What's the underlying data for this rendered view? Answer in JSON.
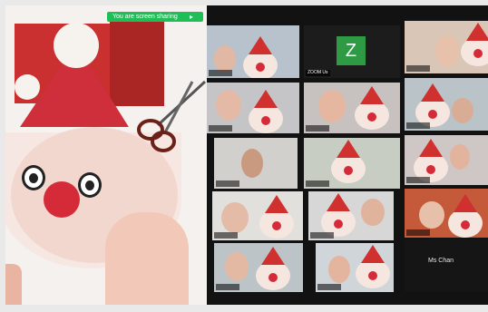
{
  "share": {
    "banner_text": "You are screen sharing",
    "banner_icon": "pin-icon"
  },
  "gallery": {
    "tiles": [
      {
        "id": "t1",
        "label": ""
      },
      {
        "id": "t2",
        "label": "ZOOM Us",
        "avatar_letter": "Z"
      },
      {
        "id": "t3",
        "label": ""
      },
      {
        "id": "t4",
        "label": ""
      },
      {
        "id": "t5",
        "label": ""
      },
      {
        "id": "t6",
        "label": ""
      },
      {
        "id": "t7",
        "label": ""
      },
      {
        "id": "t8",
        "label": ""
      },
      {
        "id": "t9",
        "label": ""
      },
      {
        "id": "t10",
        "label": ""
      },
      {
        "id": "t11",
        "label": ""
      },
      {
        "id": "t12",
        "label": ""
      },
      {
        "id": "t13",
        "label": ""
      },
      {
        "id": "t14",
        "label": ""
      },
      {
        "id": "t15",
        "label": "Ms Chan"
      }
    ]
  },
  "colors": {
    "green_banner": "#1fbf57",
    "zoom_avatar": "#2e9a43"
  }
}
